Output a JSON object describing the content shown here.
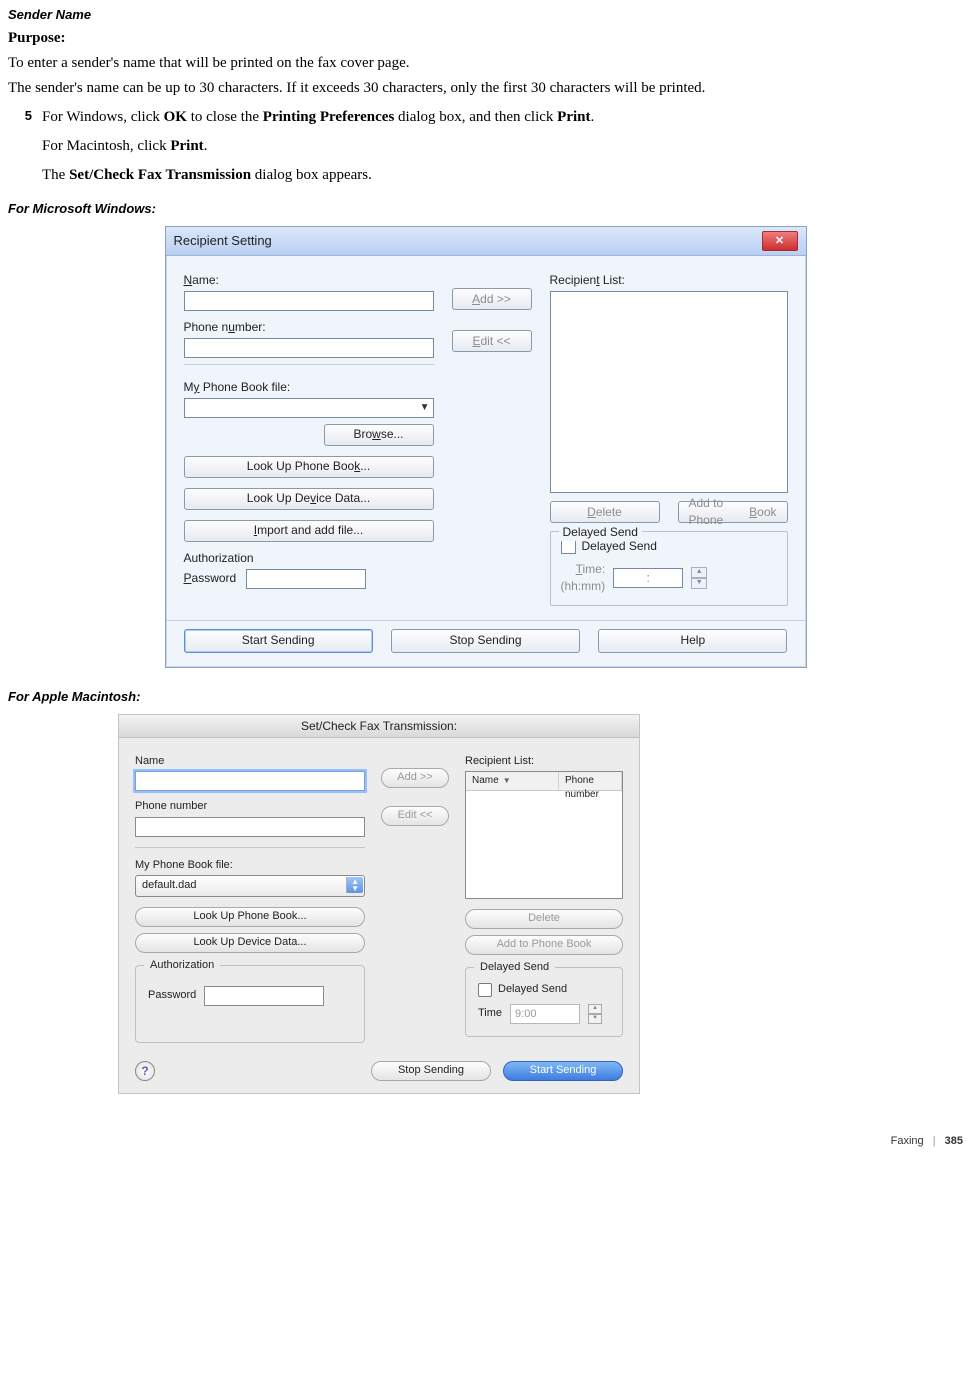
{
  "heading_sender_name": "Sender Name",
  "purpose_label": "Purpose:",
  "purpose_text": "To enter a sender's name that will be printed on the fax cover page.",
  "limit_text": "The sender's name can be up to 30 characters. If it exceeds 30 characters, only the first 30 characters will be printed.",
  "step5_num": "5",
  "step5_a": "For Windows, click ",
  "step5_ok": "OK",
  "step5_b": " to close the ",
  "step5_pp": "Printing Preferences",
  "step5_c": " dialog box, and then click ",
  "step5_print": "Print",
  "step5_d": ".",
  "step5_mac_a": "For Macintosh, click ",
  "step5_mac_print": "Print",
  "step5_mac_b": ".",
  "step5_result_a": "The ",
  "step5_result_bold": "Set/Check Fax Transmission",
  "step5_result_b": " dialog box appears.",
  "heading_windows": "For Microsoft Windows:",
  "heading_mac": "For Apple Macintosh:",
  "win": {
    "title": "Recipient Setting",
    "name_pre": "N",
    "name_post": "ame:",
    "phone_a": "Phone n",
    "phone_u": "u",
    "phone_b": "mber:",
    "pbfile_a": "M",
    "pbfile_u": "y",
    "pbfile_b": " Phone Book file:",
    "browse_a": "Bro",
    "browse_u": "w",
    "browse_b": "se...",
    "lookup_pb_a": "Look Up Phone Boo",
    "lookup_pb_u": "k",
    "lookup_pb_b": "...",
    "lookup_dev_a": "Look Up De",
    "lookup_dev_u": "v",
    "lookup_dev_b": "ice Data...",
    "import_u": "I",
    "import_a": "mport and add file...",
    "auth": "Authorization",
    "password_u": "P",
    "password_a": "assword",
    "add_u": "A",
    "add_a": "dd >>",
    "edit_u": "E",
    "edit_a": "dit <<",
    "recip_a": "Recipien",
    "recip_u": "t",
    "recip_b": " List:",
    "delete_u": "D",
    "delete_a": "elete",
    "addpb_a": "Add to Phone ",
    "addpb_u": "B",
    "addpb_b": "ook",
    "delayed_legend": "Delayed Send",
    "delayed_chk": "Delayed Send",
    "time_u": "T",
    "time_a": "ime:",
    "time_hint": "(hh:mm)",
    "time_val": ":",
    "start": "Start Sending",
    "stop": "Stop Sending",
    "help": "Help"
  },
  "mac": {
    "title": "Set/Check Fax Transmission:",
    "name": "Name",
    "phone": "Phone number",
    "pbfile": "My Phone Book file:",
    "pbval": "default.dad",
    "add": "Add >>",
    "edit": "Edit <<",
    "recip": "Recipient List:",
    "col_name": "Name",
    "col_phone": "Phone number",
    "lookup_pb": "Look Up Phone Book...",
    "lookup_dev": "Look Up Device Data...",
    "delete": "Delete",
    "addpb": "Add to Phone Book",
    "auth": "Authorization",
    "password": "Password",
    "delayed_legend": "Delayed Send",
    "delayed_chk": "Delayed Send",
    "time_lbl": "Time",
    "time_val": "9:00",
    "stop": "Stop Sending",
    "start": "Start Sending"
  },
  "footer": {
    "section": "Faxing",
    "page": "385"
  }
}
